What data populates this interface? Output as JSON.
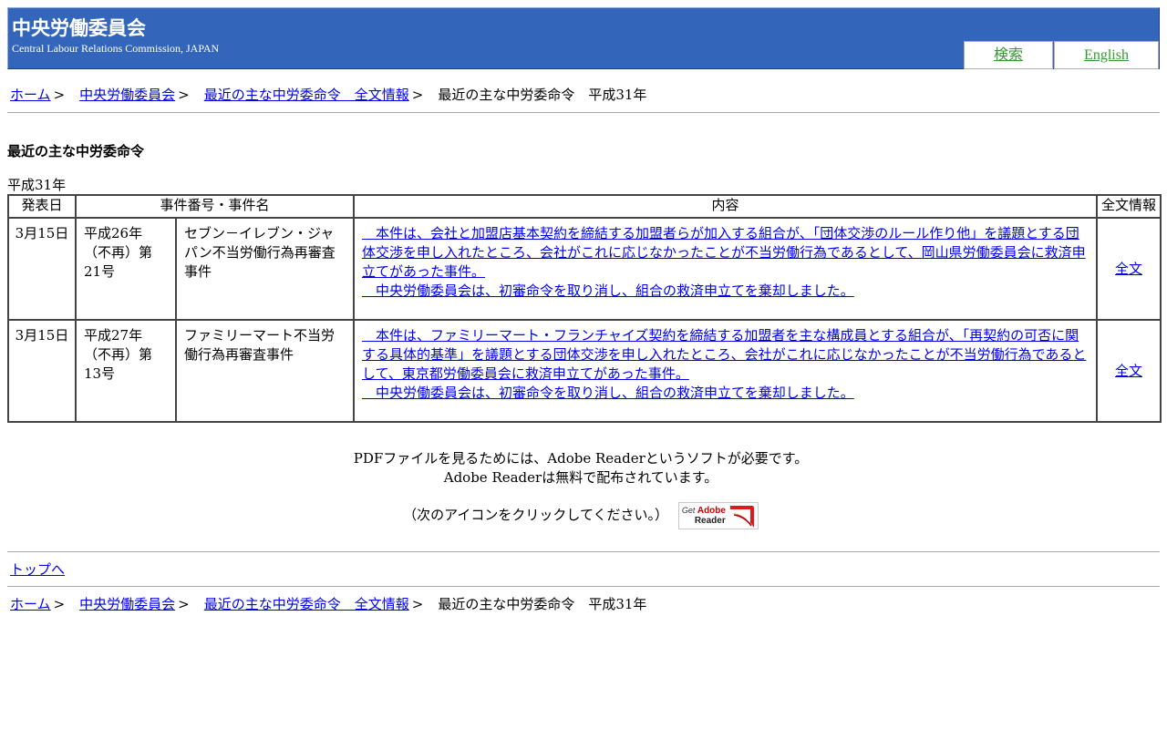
{
  "header": {
    "title": "中央労働委員会",
    "subtitle": "Central Labour Relations Commission, JAPAN",
    "nav": {
      "search": "検索",
      "english": "English"
    }
  },
  "breadcrumb": {
    "home": "ホーム",
    "clrc": "中央労働委員会",
    "orders": "最近の主な中労委命令　全文情報",
    "current": "最近の主な中労委命令　平成31年",
    "sep": ">"
  },
  "page": {
    "title": "最近の主な中労委命令",
    "year": "平成31年"
  },
  "table": {
    "headers": {
      "date": "発表日",
      "case": "事件番号・事件名",
      "content": "内容",
      "fulltext": "全文情報"
    },
    "rows": [
      {
        "date": "3月15日",
        "case_no": "平成26年（不再）第21号",
        "case_name": "セブン－イレブン・ジャパン不当労働行為再審査事件",
        "summary": "　本件は、会社と加盟店基本契約を締結する加盟者らが加入する組合が、「団体交渉のルール作り他」を議題とする団体交渉を申し入れたところ、会社がこれに応じなかったことが不当労働行為であるとして、岡山県労働委員会に救済申立てがあった事件。",
        "decision": "　中央労働委員会は、初審命令を取り消し、組合の救済申立てを棄却しました。",
        "fulltext": "全文"
      },
      {
        "date": "3月15日",
        "case_no": "平成27年（不再）第13号",
        "case_name": "ファミリーマート不当労働行為再審査事件",
        "summary": "　本件は、ファミリーマート・フランチャイズ契約を締結する加盟者を主な構成員とする組合が、「再契約の可否に関する具体的基準」を議題とする団体交渉を申し入れたところ、会社がこれに応じなかったことが不当労働行為であるとして、東京都労働委員会に救済申立てがあった事件。",
        "decision": "　中央労働委員会は、初審命令を取り消し、組合の救済申立てを棄却しました。",
        "fulltext": "全文"
      }
    ]
  },
  "pdf_note": {
    "line1": "PDFファイルを見るためには、Adobe Readerというソフトが必要です。",
    "line2": "Adobe Readerは無料で配布されています。",
    "click": "（次のアイコンをクリックしてください。）",
    "badge_get": "Get",
    "badge_adobe": "Adobe",
    "badge_reader": "Reader"
  },
  "footer": {
    "to_top": "トップへ"
  },
  "colors": {
    "header_bg": "#3366bb",
    "nav_link": "#339933",
    "link": "#0000ee"
  }
}
